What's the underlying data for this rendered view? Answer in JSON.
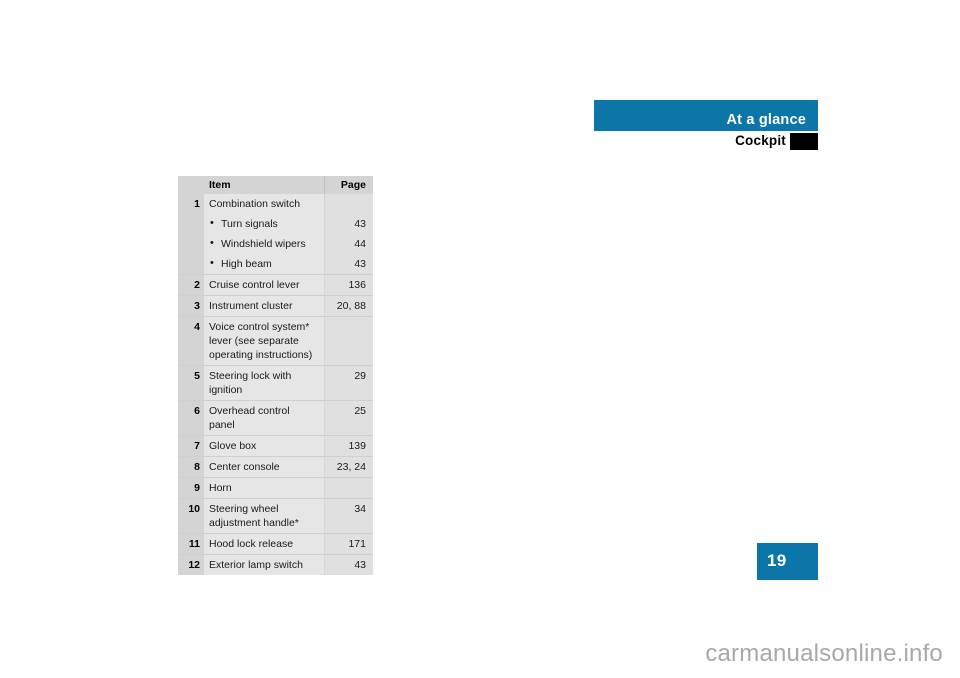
{
  "header": {
    "banner_title": "At a glance",
    "section_title": "Cockpit",
    "banner_color": "#0d76a8",
    "marker_color": "#000000"
  },
  "table": {
    "columns": {
      "number": "",
      "item": "Item",
      "page": "Page"
    },
    "rows": [
      {
        "number": "1",
        "item": "Combination switch",
        "page": ""
      },
      {
        "number": "",
        "item": "Turn signals",
        "page": "43",
        "bullet": true
      },
      {
        "number": "",
        "item": "Windshield wipers",
        "page": "44",
        "bullet": true
      },
      {
        "number": "",
        "item": "High beam",
        "page": "43",
        "bullet": true
      },
      {
        "number": "2",
        "item": "Cruise control lever",
        "page": "136"
      },
      {
        "number": "3",
        "item": "Instrument cluster",
        "page": "20, 88"
      },
      {
        "number": "4",
        "item": "Voice control system* lever (see separate operating instructions)",
        "page": ""
      },
      {
        "number": "5",
        "item": "Steering lock with ignition",
        "page": "29"
      },
      {
        "number": "6",
        "item": "Overhead control panel",
        "page": "25"
      },
      {
        "number": "7",
        "item": "Glove box",
        "page": "139"
      },
      {
        "number": "8",
        "item": "Center console",
        "page": "23, 24"
      },
      {
        "number": "9",
        "item": "Horn",
        "page": ""
      },
      {
        "number": "10",
        "item": "Steering wheel adjustment handle*",
        "page": "34"
      },
      {
        "number": "11",
        "item": "Hood lock release",
        "page": "171"
      },
      {
        "number": "12",
        "item": "Exterior lamp switch",
        "page": "43"
      }
    ]
  },
  "footer": {
    "page_number": "19",
    "watermark": "carmanualsonline.info"
  }
}
